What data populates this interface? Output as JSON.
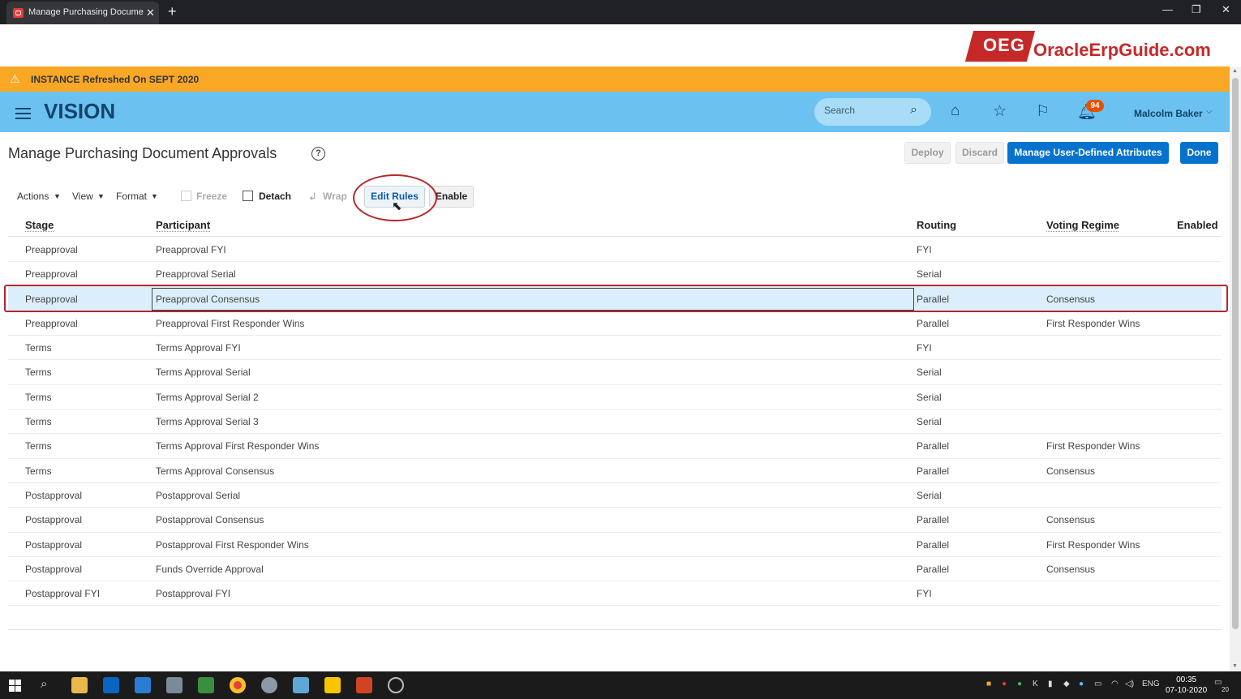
{
  "browser": {
    "tab_title": "Manage Purchasing Document A",
    "tab_close": "✕",
    "new_tab": "+",
    "window_controls": [
      "—",
      "❐",
      "✕"
    ]
  },
  "site_logo": {
    "box": "OEG",
    "text": "OracleErpGuide.com"
  },
  "notice": {
    "icon": "warning-icon",
    "text": "INSTANCE Refreshed On SEPT 2020"
  },
  "header": {
    "brand": "VISION",
    "search_placeholder": "Search",
    "notification_count": "94",
    "user_name": "Malcolm Baker"
  },
  "page": {
    "title": "Manage Purchasing Document Approvals",
    "help": "?",
    "buttons": {
      "deploy": "Deploy",
      "discard": "Discard",
      "manage_attributes": "Manage User-Defined Attributes",
      "done": "Done"
    }
  },
  "toolbar": {
    "actions": "Actions",
    "view": "View",
    "format": "Format",
    "freeze": "Freeze",
    "detach": "Detach",
    "wrap": "Wrap",
    "edit_rules": "Edit Rules",
    "enable": "Enable"
  },
  "table": {
    "columns": {
      "stage": "Stage",
      "participant": "Participant",
      "routing": "Routing",
      "voting": "Voting Regime",
      "enabled": "Enabled"
    },
    "rows": [
      {
        "stage": "Preapproval",
        "participant": "Preapproval FYI",
        "routing": "FYI",
        "voting": ""
      },
      {
        "stage": "Preapproval",
        "participant": "Preapproval Serial",
        "routing": "Serial",
        "voting": ""
      },
      {
        "stage": "Preapproval",
        "participant": "Preapproval Consensus",
        "routing": "Parallel",
        "voting": "Consensus",
        "selected": true
      },
      {
        "stage": "Preapproval",
        "participant": "Preapproval First Responder Wins",
        "routing": "Parallel",
        "voting": "First Responder Wins"
      },
      {
        "stage": "Terms",
        "participant": "Terms Approval FYI",
        "routing": "FYI",
        "voting": ""
      },
      {
        "stage": "Terms",
        "participant": "Terms Approval Serial",
        "routing": "Serial",
        "voting": ""
      },
      {
        "stage": "Terms",
        "participant": "Terms Approval Serial 2",
        "routing": "Serial",
        "voting": ""
      },
      {
        "stage": "Terms",
        "participant": "Terms Approval Serial 3",
        "routing": "Serial",
        "voting": ""
      },
      {
        "stage": "Terms",
        "participant": "Terms Approval First Responder Wins",
        "routing": "Parallel",
        "voting": "First Responder Wins"
      },
      {
        "stage": "Terms",
        "participant": "Terms Approval Consensus",
        "routing": "Parallel",
        "voting": "Consensus"
      },
      {
        "stage": "Postapproval",
        "participant": "Postapproval Serial",
        "routing": "Serial",
        "voting": ""
      },
      {
        "stage": "Postapproval",
        "participant": "Postapproval Consensus",
        "routing": "Parallel",
        "voting": "Consensus"
      },
      {
        "stage": "Postapproval",
        "participant": "Postapproval First Responder Wins",
        "routing": "Parallel",
        "voting": "First Responder Wins"
      },
      {
        "stage": "Postapproval",
        "participant": "Funds Override Approval",
        "routing": "Parallel",
        "voting": "Consensus"
      },
      {
        "stage": "Postapproval FYI",
        "participant": "Postapproval FYI",
        "routing": "FYI",
        "voting": ""
      }
    ]
  },
  "taskbar": {
    "language": "ENG",
    "time": "00:35",
    "date": "07-10-2020",
    "notification_count": "20"
  },
  "colors": {
    "header_bg": "#6bc2f0",
    "brand": "#14436b",
    "notice_bg": "#f9a825",
    "primary_button": "#0572ce",
    "selected_row": "#dbeefb",
    "highlight_red": "#b5272d"
  }
}
